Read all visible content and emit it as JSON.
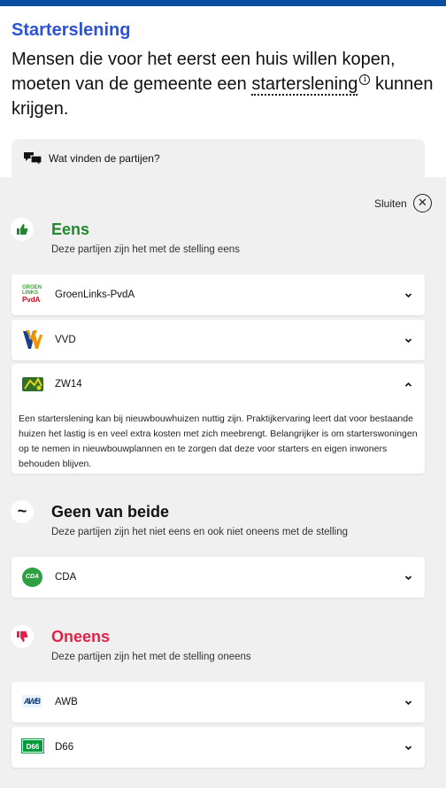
{
  "header": {
    "title": "Starterslening",
    "statement_before": "Mensen die voor het eerst een huis willen kopen, moeten van de gemeente een ",
    "statement_term": "starterslening",
    "statement_after": "kunnen krijgen.",
    "info_icon": "info-icon"
  },
  "panel": {
    "label": "Wat vinden de partijen?",
    "close_label": "Sluiten",
    "close_icon": "close-icon"
  },
  "groups": {
    "eens": {
      "title": "Eens",
      "subtitle": "Deze partijen zijn het met de stelling eens",
      "color": "#1f8a2b",
      "icon": "thumbs-up-icon",
      "parties": [
        {
          "name": "GroenLinks-PvdA",
          "logo_lines": [
            "GROEN",
            "LINKS",
            "PvdA"
          ],
          "expanded": false
        },
        {
          "name": "VVD",
          "logo_text": "VVD",
          "expanded": false
        },
        {
          "name": "ZW14",
          "expanded": true,
          "explanation": "Een starterslening kan bij nieuwbouwhuizen nuttig zijn. Praktijkervaring leert dat voor bestaande huizen het lastig is en veel extra kosten met zich meebrengt. Belangrijker is om starterswoningen op te nemen in nieuwbouwplannen en te zorgen dat deze voor starters en eigen inwoners behouden blijven."
        }
      ]
    },
    "geen": {
      "title": "Geen van beide",
      "subtitle": "Deze partijen zijn het niet eens en ook niet oneens met de stelling",
      "color": "#111111",
      "icon": "tilde-icon",
      "icon_glyph": "~",
      "parties": [
        {
          "name": "CDA",
          "logo_text": "CDA",
          "expanded": false
        }
      ]
    },
    "oneens": {
      "title": "Oneens",
      "subtitle": "Deze partijen zijn het met de stelling oneens",
      "color": "#e0224a",
      "icon": "thumbs-down-icon",
      "parties": [
        {
          "name": "AWB",
          "logo_text": "AWB",
          "expanded": false
        },
        {
          "name": "D66",
          "logo_text": "D66",
          "expanded": false
        }
      ]
    }
  },
  "colors": {
    "accent_blue": "#2d52d6",
    "top_bar": "#0b4fa3",
    "background": "#f0f0f0"
  }
}
